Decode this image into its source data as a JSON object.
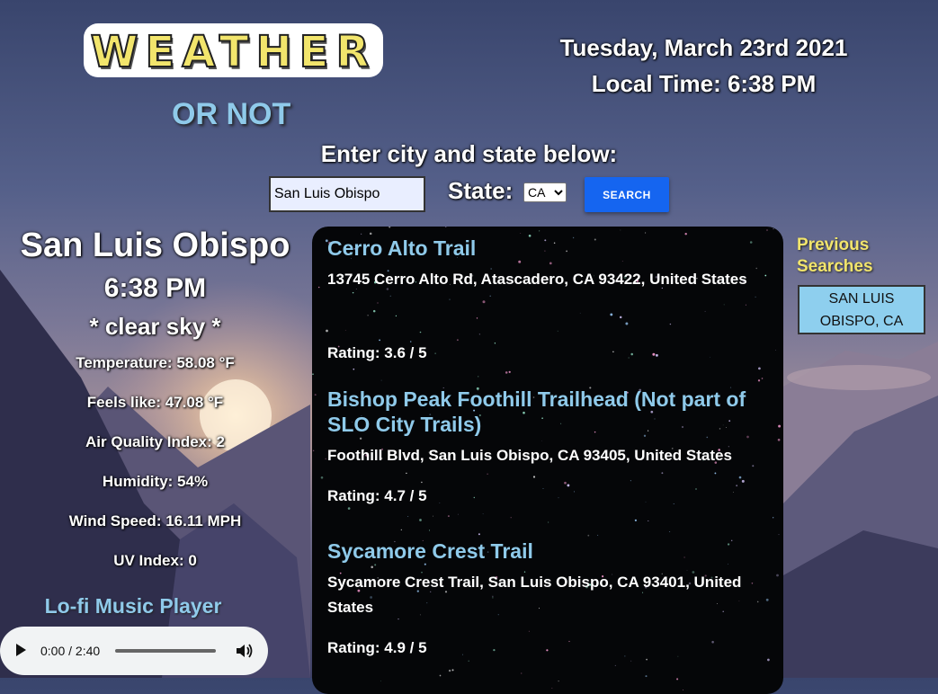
{
  "header": {
    "logo_text": "WEATHER",
    "tagline": "OR NOT",
    "date": "Tuesday, March 23rd 2021",
    "local_time": "Local Time: 6:38 PM"
  },
  "search": {
    "prompt": "Enter city and state below:",
    "city_value": "San Luis Obispo",
    "state_label": "State:",
    "state_selected": "CA",
    "button_label": "SEARCH"
  },
  "weather": {
    "city": "San Luis Obispo",
    "time": "6:38 PM",
    "sky": "* clear sky *",
    "stats": [
      "Temperature: 58.08 °F",
      "Feels like: 47.08 °F",
      "Air Quality Index: 2",
      "Humidity: 54%",
      "Wind Speed: 16.11 MPH",
      "UV Index: 0"
    ]
  },
  "music": {
    "title": "Lo-fi Music Player",
    "time_display": "0:00 / 2:40",
    "progress": 0
  },
  "trails": [
    {
      "name": "Cerro Alto Trail",
      "address": "13745 Cerro Alto Rd, Atascadero, CA 93422, United States",
      "rating": "Rating: 3.6 / 5"
    },
    {
      "name": "Bishop Peak Foothill Trailhead (Not part of SLO City Trails)",
      "address": "Foothill Blvd, San Luis Obispo, CA 93405, United States",
      "rating": "Rating: 4.7 / 5"
    },
    {
      "name": "Sycamore Crest Trail",
      "address": "Sycamore Crest Trail, San Luis Obispo, CA 93401, United States",
      "rating": "Rating: 4.9 / 5"
    }
  ],
  "previous_searches": {
    "title": "Previous Searches",
    "items": [
      "SAN LUIS OBISPO, CA"
    ]
  },
  "colors": {
    "accent_blue": "#8fcaea",
    "logo_yellow": "#f2e56c",
    "button_blue": "#1565f0",
    "panel_black": "#050608"
  }
}
